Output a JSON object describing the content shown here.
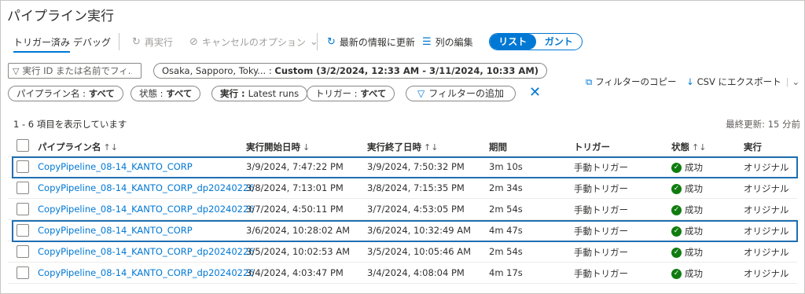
{
  "page": {
    "title": "パイプライン実行"
  },
  "toolbar": {
    "tab_triggered": "トリガー済み",
    "tab_debug": "デバッグ",
    "rerun": "再実行",
    "cancel_options": "キャンセルのオプション",
    "refresh": "最新の情報に更新",
    "edit_columns": "列の編集",
    "view_list": "リスト",
    "view_gantt": "ガント"
  },
  "filters": {
    "search_placeholder": "実行 ID または名前でフィ...",
    "time_prefix": "Osaka, Sapporo, Toky... : ",
    "time_value": "Custom (3/2/2024, 12:33 AM - 3/11/2024, 10:33 AM)",
    "pipeline_name_label": "パイプライン名 : ",
    "pipeline_name_value": "すべて",
    "status_label": "状態 : ",
    "status_value": "すべて",
    "runs_label": "実行 : ",
    "runs_value": "Latest runs",
    "trigger_label": "トリガー : ",
    "trigger_value": "すべて",
    "add_filter": "フィルターの追加"
  },
  "actions": {
    "copy_filters": "フィルターのコピー",
    "export_csv": "CSV にエクスポート"
  },
  "summary": {
    "count": "1 - 6 項目を表示しています",
    "last_updated": "最終更新: 15 分前"
  },
  "table": {
    "headers": {
      "name": "パイプライン名",
      "start": "実行開始日時",
      "end": "実行終了日時",
      "duration": "期間",
      "trigger": "トリガー",
      "status": "状態",
      "run": "実行"
    },
    "rows": [
      {
        "name": "CopyPipeline_08-14_KANTO_CORP",
        "start": "3/9/2024, 7:47:22 PM",
        "end": "3/9/2024, 7:50:32 PM",
        "duration": "3m 10s",
        "trigger": "手動トリガー",
        "status": "成功",
        "run": "オリジナル"
      },
      {
        "name": "CopyPipeline_08-14_KANTO_CORP_dp20240226",
        "start": "3/8/2024, 7:13:01 PM",
        "end": "3/8/2024, 7:15:35 PM",
        "duration": "2m 34s",
        "trigger": "手動トリガー",
        "status": "成功",
        "run": "オリジナル"
      },
      {
        "name": "CopyPipeline_08-14_KANTO_CORP_dp20240226",
        "start": "3/7/2024, 4:50:11 PM",
        "end": "3/7/2024, 4:53:05 PM",
        "duration": "2m 54s",
        "trigger": "手動トリガー",
        "status": "成功",
        "run": "オリジナル"
      },
      {
        "name": "CopyPipeline_08-14_KANTO_CORP",
        "start": "3/6/2024, 10:28:02 AM",
        "end": "3/6/2024, 10:32:49 AM",
        "duration": "4m 47s",
        "trigger": "手動トリガー",
        "status": "成功",
        "run": "オリジナル"
      },
      {
        "name": "CopyPipeline_08-14_KANTO_CORP_dp20240226",
        "start": "3/5/2024, 10:02:53 AM",
        "end": "3/5/2024, 10:05:46 AM",
        "duration": "2m 54s",
        "trigger": "手動トリガー",
        "status": "成功",
        "run": "オリジナル"
      },
      {
        "name": "CopyPipeline_08-14_KANTO_CORP_dp20240226",
        "start": "3/4/2024, 4:03:47 PM",
        "end": "3/4/2024, 4:08:04 PM",
        "duration": "4m 17s",
        "trigger": "手動トリガー",
        "status": "成功",
        "run": "オリジナル"
      }
    ]
  }
}
